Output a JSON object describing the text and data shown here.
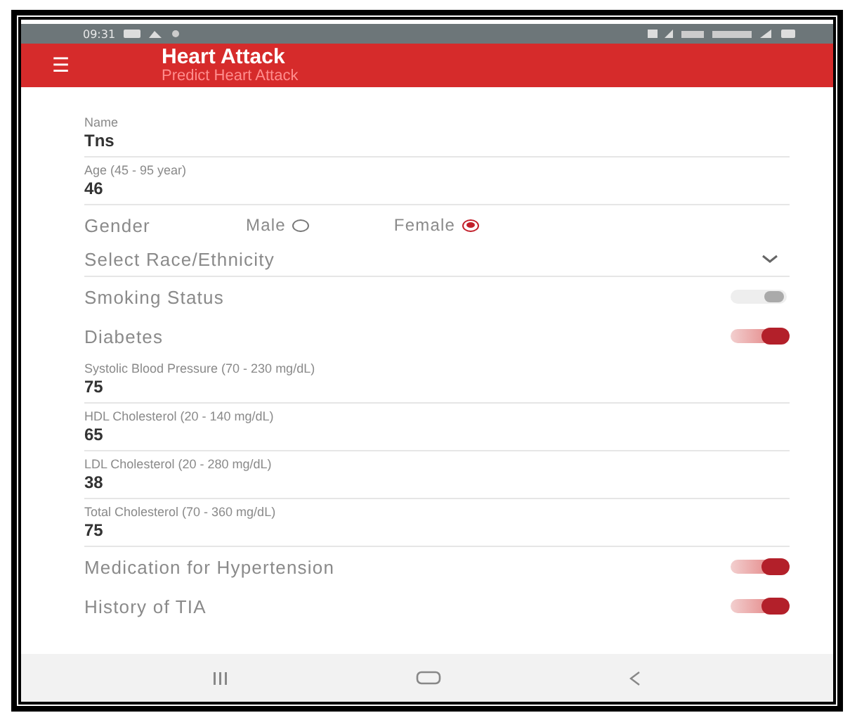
{
  "status_bar": {
    "time": "09:31"
  },
  "app_bar": {
    "menu_icon": "☰",
    "title": "Heart Attack",
    "subtitle": "Predict Heart Attack"
  },
  "form": [
    {
      "kind": "text",
      "label": "Name",
      "value": "Tns"
    },
    {
      "kind": "text",
      "label": "Age (45 - 95 year)",
      "value": "46"
    },
    {
      "kind": "radio",
      "label": "Gender",
      "options": [
        {
          "label": "Male",
          "selected": false
        },
        {
          "label": "Female",
          "selected": true
        }
      ]
    },
    {
      "kind": "select",
      "label": "Select Race/Ethnicity"
    },
    {
      "kind": "switch",
      "label": "Smoking Status",
      "on": false
    },
    {
      "kind": "switch",
      "label": "Diabetes",
      "on": true
    },
    {
      "kind": "text",
      "label": "Systolic Blood Pressure (70 - 230 mg/dL)",
      "value": "75"
    },
    {
      "kind": "text",
      "label": "HDL Cholesterol (20 - 140 mg/dL)",
      "value": "65"
    },
    {
      "kind": "text",
      "label": "LDL Cholesterol (20 - 280 mg/dL)",
      "value": "38"
    },
    {
      "kind": "text",
      "label": "Total Cholesterol (70 - 360 mg/dL)",
      "value": "75"
    },
    {
      "kind": "switch",
      "label": "Medication for Hypertension",
      "on": true
    },
    {
      "kind": "switch",
      "label": "History of TIA",
      "on": true
    }
  ]
}
